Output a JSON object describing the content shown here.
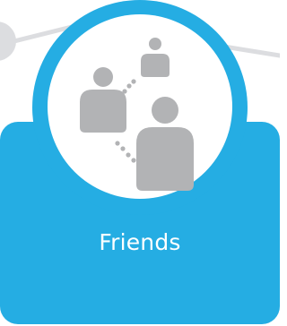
{
  "tile": {
    "title": "Friends",
    "icon": "friends-network-icon"
  },
  "colors": {
    "accent": "#25ade3",
    "icon_gray": "#b2b3b5",
    "line_gray": "#dcdde0",
    "text": "#ffffff"
  }
}
